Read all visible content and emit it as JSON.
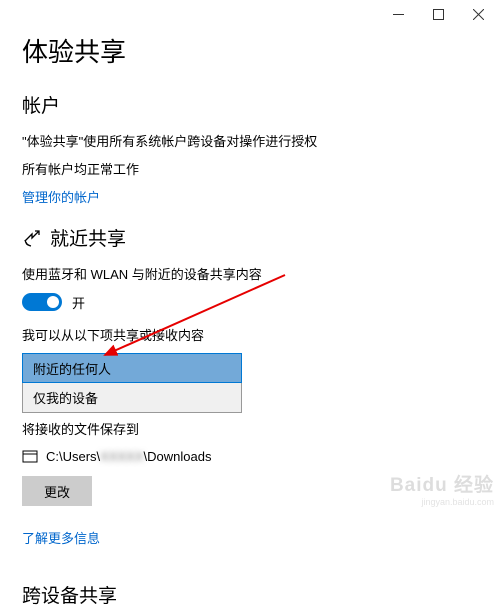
{
  "titlebar": {
    "minimize": "—",
    "maximize": "□",
    "close": "✕"
  },
  "page": {
    "title": "体验共享"
  },
  "account": {
    "title": "帐户",
    "line1": "\"体验共享\"使用所有系统帐户跨设备对操作进行授权",
    "line2": "所有帐户均正常工作",
    "manage_link": "管理你的帐户"
  },
  "nearby": {
    "title": "就近共享",
    "desc": "使用蓝牙和 WLAN 与附近的设备共享内容",
    "toggle_on_label": "开",
    "receive_label": "我可以从以下项共享或接收内容",
    "dropdown": {
      "selected": "附近的任何人",
      "option": "仅我的设备"
    },
    "save_location_label": "将接收的文件保存到",
    "path_prefix": "C:\\Users\\",
    "path_hidden": "XXXXX",
    "path_suffix": "\\Downloads",
    "change_btn": "更改",
    "learn_more": "了解更多信息"
  },
  "cross": {
    "title": "跨设备共享"
  },
  "watermark": {
    "top": "Baidu 经验",
    "bot": "jingyan.baidu.com"
  }
}
